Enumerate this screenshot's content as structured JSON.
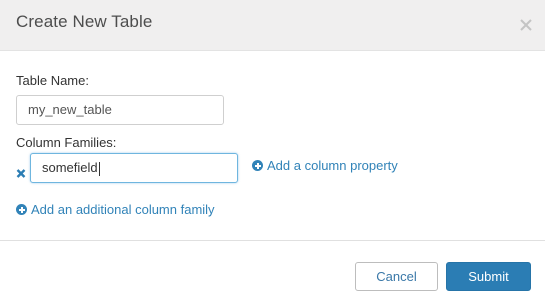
{
  "dialog": {
    "title": "Create New Table",
    "close_icon": "close-icon"
  },
  "form": {
    "table_name_label": "Table Name:",
    "table_name_value": "my_new_table",
    "column_families_label": "Column Families:",
    "column_family_value": "somefield",
    "remove_icon": "remove-x-icon",
    "add_column_property": "Add a column property",
    "add_column_family": "Add an additional column family"
  },
  "footer": {
    "cancel_label": "Cancel",
    "submit_label": "Submit"
  },
  "colors": {
    "header_bg": "#f0efef",
    "link": "#3183b8",
    "primary_button": "#2b7db4",
    "focus_border": "#6fb6df"
  }
}
